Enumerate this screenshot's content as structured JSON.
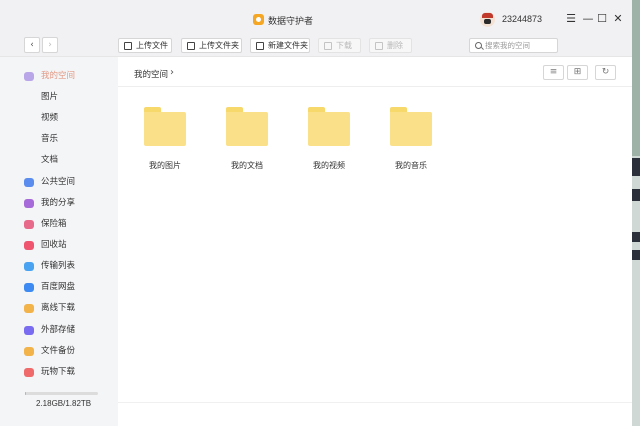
{
  "window": {
    "title": "数据守护者",
    "username": "23244873",
    "minimize_glyph": "☰",
    "min_glyph": "—",
    "max_glyph": "☐",
    "close_glyph": "✕"
  },
  "toolbar": {
    "back_glyph": "‹",
    "forward_glyph": "›",
    "buttons": [
      {
        "label": "上传文件",
        "enabled": true
      },
      {
        "label": "上传文件夹",
        "enabled": true
      },
      {
        "label": "新建文件夹",
        "enabled": true
      },
      {
        "label": "下载",
        "enabled": false
      },
      {
        "label": "删除",
        "enabled": false
      }
    ],
    "search_placeholder": "搜索我的空间"
  },
  "sidebar": {
    "items": [
      {
        "label": "我的空间",
        "active": true,
        "icon": "my-space-icon",
        "color": "#b9a6e8"
      },
      {
        "label": "图片",
        "sub": true
      },
      {
        "label": "视频",
        "sub": true
      },
      {
        "label": "音乐",
        "sub": true
      },
      {
        "label": "文档",
        "sub": true
      },
      {
        "label": "公共空间",
        "icon": "public-space-icon",
        "color": "#5b8def"
      },
      {
        "label": "我的分享",
        "icon": "share-icon",
        "color": "#a66bd8"
      },
      {
        "label": "保险箱",
        "icon": "safe-icon",
        "color": "#e86a8a"
      },
      {
        "label": "回收站",
        "icon": "recycle-bin-icon",
        "color": "#f0556f"
      },
      {
        "label": "传输列表",
        "icon": "transfer-icon",
        "color": "#4aa3f0"
      },
      {
        "label": "百度网盘",
        "icon": "baidu-netdisk-icon",
        "color": "#3d8bf2"
      },
      {
        "label": "离线下载",
        "icon": "offline-download-icon",
        "color": "#f2b34a"
      },
      {
        "label": "外部存储",
        "icon": "external-storage-icon",
        "color": "#7a6cf0"
      },
      {
        "label": "文件备份",
        "icon": "backup-icon",
        "color": "#f2b34a"
      },
      {
        "label": "玩物下载",
        "icon": "toy-download-icon",
        "color": "#ef6a6a"
      }
    ],
    "storage": {
      "text": "2.18GB/1.82TB",
      "used_fraction": 0.0012
    }
  },
  "main": {
    "breadcrumb": "我的空间",
    "breadcrumb_sep": "›",
    "view_list_glyph": "≡",
    "view_grid_glyph": "⊞",
    "refresh_glyph": "↻",
    "folders": [
      {
        "name": "我的图片"
      },
      {
        "name": "我的文档"
      },
      {
        "name": "我的视频"
      },
      {
        "name": "我的音乐"
      }
    ]
  },
  "colors": {
    "accent_active": "#e29a86",
    "folder": "#fbe08a",
    "folder_tab": "#f7d86b"
  }
}
